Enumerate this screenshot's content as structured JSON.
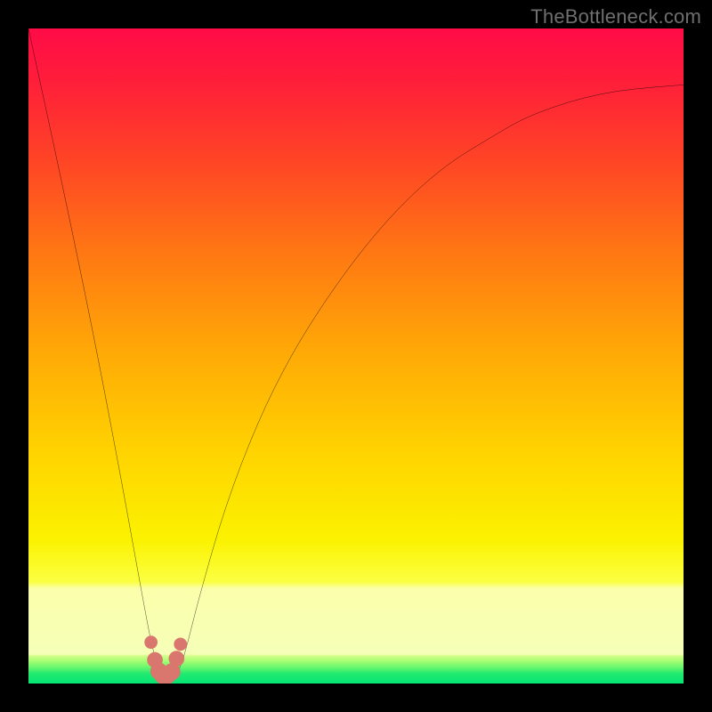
{
  "watermark": "TheBottleneck.com",
  "chart_data": {
    "type": "line",
    "title": "",
    "xlabel": "",
    "ylabel": "",
    "xlim": [
      0,
      100
    ],
    "ylim": [
      0,
      100
    ],
    "x": [
      0,
      5,
      10,
      14,
      16,
      18,
      19,
      20,
      21,
      22,
      23,
      24,
      26,
      30,
      35,
      40,
      45,
      50,
      55,
      60,
      65,
      70,
      75,
      80,
      85,
      90,
      95,
      100
    ],
    "values": [
      100,
      77,
      53,
      32,
      21,
      10,
      5,
      2,
      1,
      1,
      2,
      5,
      13,
      27,
      40,
      50,
      58,
      65,
      71,
      76,
      80,
      83,
      86,
      88,
      89.5,
      90.5,
      91,
      91.4
    ],
    "minimum_x_range": [
      19,
      23
    ],
    "annotations": [],
    "grid": false,
    "legend": false,
    "background_gradient": {
      "stops": [
        {
          "pos": 0.0,
          "color": "#ff0b47"
        },
        {
          "pos": 0.08,
          "color": "#ff1e3a"
        },
        {
          "pos": 0.2,
          "color": "#ff4426"
        },
        {
          "pos": 0.35,
          "color": "#ff7a12"
        },
        {
          "pos": 0.5,
          "color": "#ffab06"
        },
        {
          "pos": 0.65,
          "color": "#ffd400"
        },
        {
          "pos": 0.78,
          "color": "#fbf200"
        },
        {
          "pos": 0.845,
          "color": "#fbff42"
        },
        {
          "pos": 0.855,
          "color": "#fbffab"
        },
        {
          "pos": 0.955,
          "color": "#f6ffb8"
        },
        {
          "pos": 0.958,
          "color": "#d2ff8a"
        },
        {
          "pos": 0.965,
          "color": "#a8ff74"
        },
        {
          "pos": 0.975,
          "color": "#6bf76f"
        },
        {
          "pos": 0.985,
          "color": "#21ea6f"
        },
        {
          "pos": 1.0,
          "color": "#06e574"
        }
      ]
    },
    "bump_markers": {
      "color": "#d9766e",
      "points": [
        {
          "x": 18.7,
          "y": 6.3,
          "r": 1.0
        },
        {
          "x": 19.3,
          "y": 3.6,
          "r": 1.2
        },
        {
          "x": 19.9,
          "y": 1.9,
          "r": 1.3
        },
        {
          "x": 20.5,
          "y": 1.2,
          "r": 1.3
        },
        {
          "x": 21.2,
          "y": 1.2,
          "r": 1.3
        },
        {
          "x": 21.9,
          "y": 1.8,
          "r": 1.3
        },
        {
          "x": 22.6,
          "y": 3.8,
          "r": 1.2
        },
        {
          "x": 23.2,
          "y": 6.0,
          "r": 1.0
        }
      ]
    }
  }
}
